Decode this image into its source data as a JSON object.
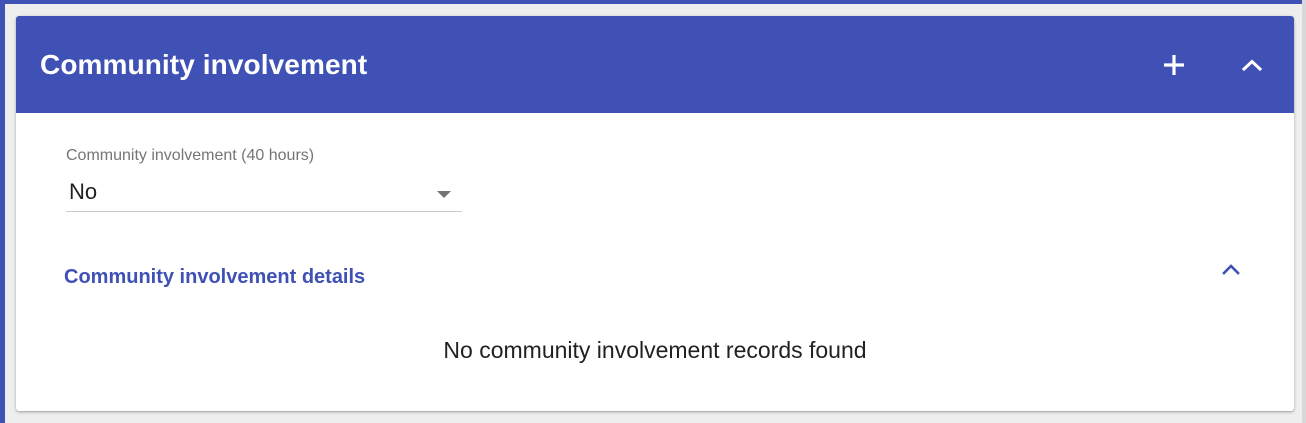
{
  "panel": {
    "title": "Community involvement",
    "header_color": "#3f51b5",
    "actions": {
      "add_icon": "plus-icon",
      "collapse_icon": "chevron-up-icon"
    }
  },
  "field": {
    "label": "Community involvement (40 hours)",
    "value": "No",
    "caret_icon": "dropdown-caret-icon"
  },
  "details": {
    "title": "Community involvement details",
    "toggle_icon": "chevron-up-icon",
    "empty_message": "No community involvement records found"
  }
}
